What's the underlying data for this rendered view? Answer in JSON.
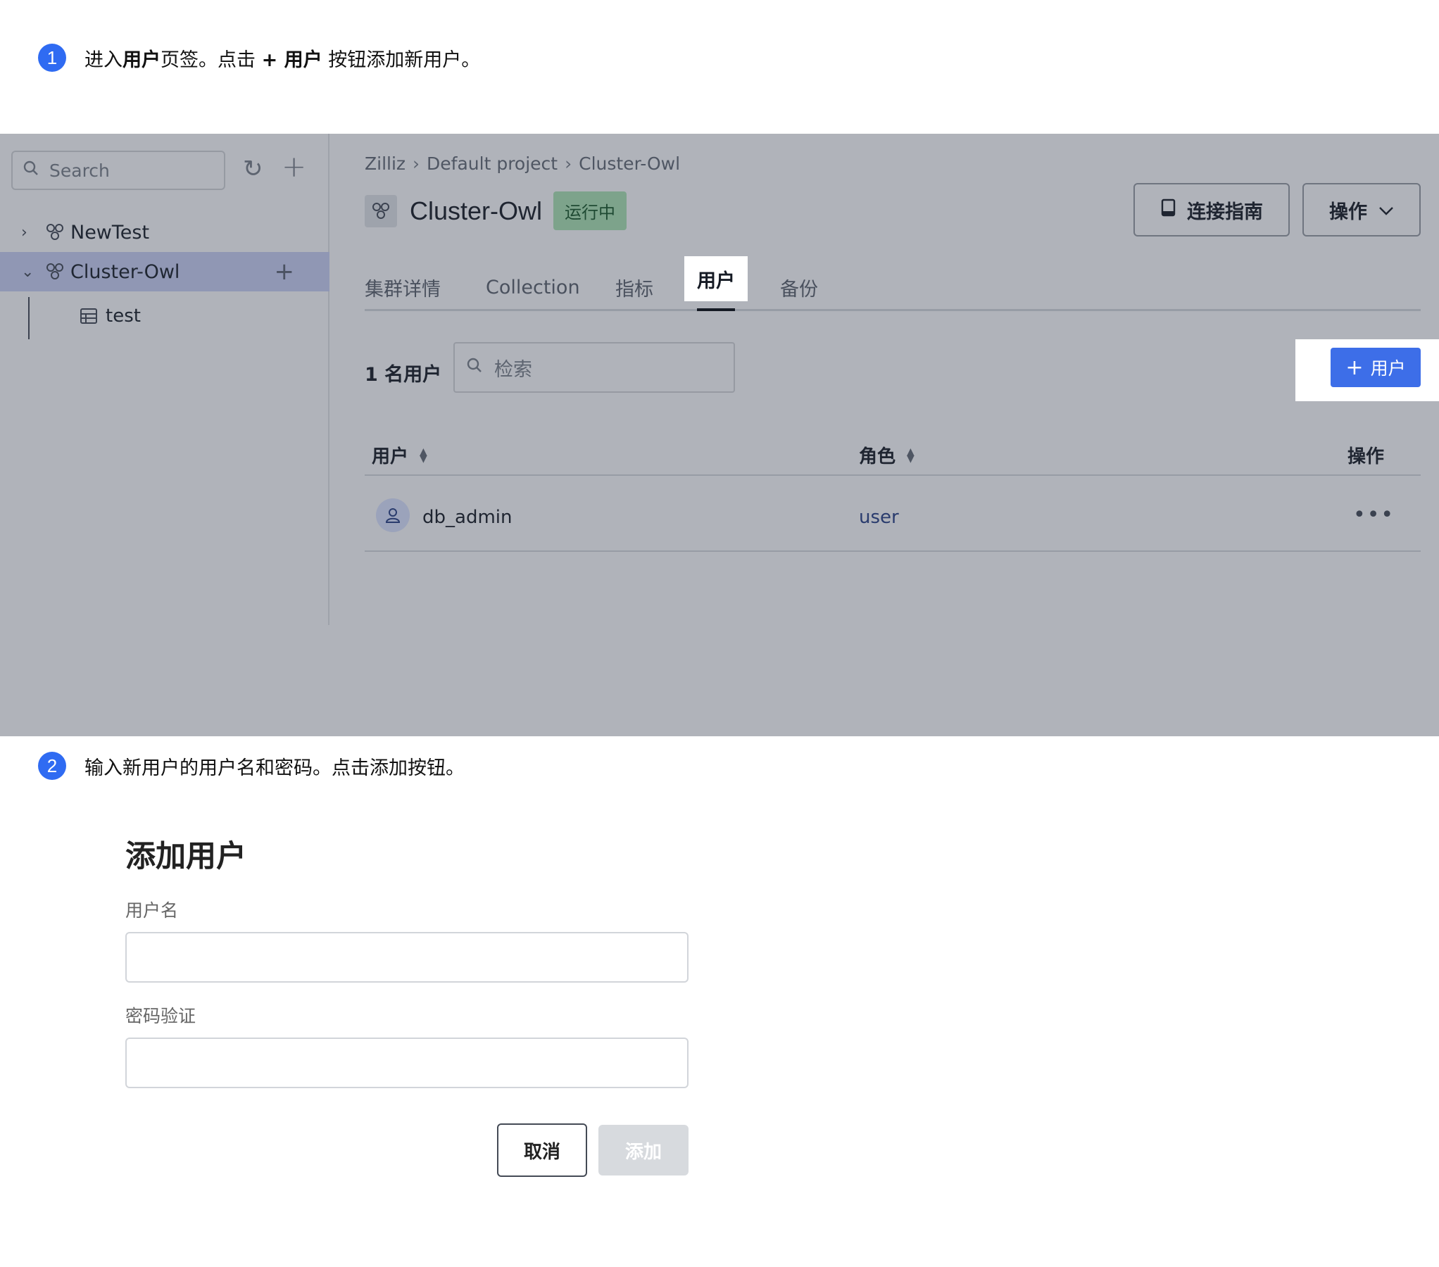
{
  "steps": [
    {
      "number": "1",
      "parts": [
        "进入",
        "用户",
        "页签。点击 ",
        "+ 用户",
        " 按钮添加新用户。"
      ]
    },
    {
      "number": "2",
      "text": "输入新用户的用户名和密码。点击添加按钮。"
    }
  ],
  "sidebar": {
    "search_placeholder": "Search",
    "tree": [
      {
        "label": "NewTest",
        "expanded": false
      },
      {
        "label": "Cluster-Owl",
        "expanded": true,
        "selected": true,
        "children": [
          {
            "label": "test"
          }
        ]
      }
    ]
  },
  "breadcrumb": [
    "Zilliz",
    "Default project",
    "Cluster-Owl"
  ],
  "cluster": {
    "name": "Cluster-Owl",
    "status": "运行中"
  },
  "header_buttons": {
    "connect": "连接指南",
    "ops": "操作"
  },
  "tabs": [
    {
      "label": "集群详情"
    },
    {
      "label": "Collection"
    },
    {
      "label": "指标"
    },
    {
      "label": "用户",
      "active": true
    },
    {
      "label": "备份"
    }
  ],
  "users_panel": {
    "count_label": "1 名用户",
    "search_placeholder": "检索",
    "add_button": "用户"
  },
  "table": {
    "columns": [
      "用户",
      "角色",
      "操作"
    ],
    "rows": [
      {
        "user": "db_admin",
        "role": "user",
        "actions": "•••"
      }
    ]
  },
  "dialog": {
    "title": "添加用户",
    "username_label": "用户名",
    "password_label": "密码验证",
    "cancel": "取消",
    "submit": "添加"
  },
  "colors": {
    "primary": "#3d6ee8",
    "badge": "#2f6bf2",
    "overlay": "#b0b3ba",
    "status": "#7da38b"
  }
}
